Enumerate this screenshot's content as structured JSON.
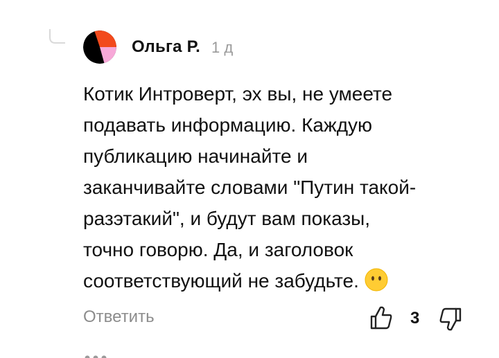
{
  "comment": {
    "author": "Ольга Р.",
    "time": "1 д",
    "text_lines": [
      "Котик Интроверт, эх вы, не умеете",
      "подавать информацию. Каждую",
      "публикацию начинайте и",
      "заканчивайте словами \"Путин такой-",
      "разэтакий\", и будут вам показы,",
      "точно говорю. Да, и заголовок",
      "соответствующий не забудьте."
    ],
    "emoji": "neutral-face-emoji"
  },
  "actions": {
    "reply_label": "Ответить",
    "like_count": "3",
    "like_icon": "thumbs-up-icon",
    "dislike_icon": "thumbs-down-icon"
  },
  "colors": {
    "avatar_orange": "#f24a1c",
    "avatar_pink": "#f7a8d8",
    "avatar_black": "#000000",
    "emoji_yellow": "#ffcc33"
  }
}
